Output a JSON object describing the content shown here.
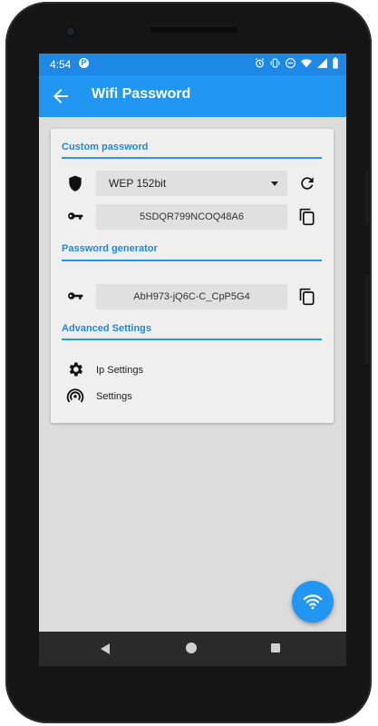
{
  "status_bar": {
    "time": "4:54",
    "notification_badge": "P",
    "icons": [
      "alarm-icon",
      "vibrate-icon",
      "do-not-disturb-icon",
      "wifi-icon",
      "signal-icon",
      "battery-icon"
    ]
  },
  "app_bar": {
    "title": "Wifi Password",
    "back_icon": "arrow-back-icon"
  },
  "custom_password": {
    "title": "Custom password",
    "encryption": {
      "selected": "WEP 152bit",
      "icon": "shield-icon"
    },
    "password": "5SDQR799NCOQ48A6",
    "refresh_icon": "refresh-icon",
    "copy_icon": "copy-icon"
  },
  "password_generator": {
    "title": "Password generator",
    "password": "AbH973-jQ6C-C_CpP5G4",
    "copy_icon": "copy-icon"
  },
  "advanced_settings": {
    "title": "Advanced Settings",
    "items": [
      {
        "label": "Ip Settings",
        "icon": "gear-icon"
      },
      {
        "label": "Settings",
        "icon": "wireless-settings-icon"
      }
    ]
  },
  "fab": {
    "icon": "wifi-icon"
  },
  "colors": {
    "primary": "#2196f3",
    "status_bar": "#1e88e5",
    "section_title": "#1e88e5"
  }
}
